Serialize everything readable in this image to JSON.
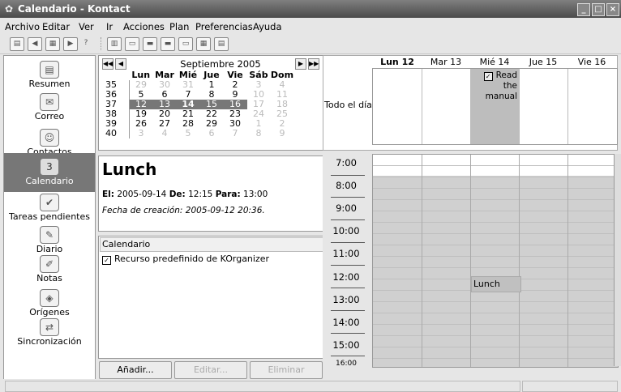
{
  "window": {
    "title": "Calendario - Kontact"
  },
  "menu": [
    "Archivo",
    "Editar",
    "Ver",
    "Ir",
    "Acciones",
    "Plan",
    "Preferencias",
    "Ayuda"
  ],
  "sidebar": {
    "items": [
      {
        "label": "Resumen",
        "icon": "summary-icon"
      },
      {
        "label": "Correo",
        "icon": "mail-icon"
      },
      {
        "label": "Contactos",
        "icon": "contacts-icon"
      },
      {
        "label": "Calendario",
        "icon": "calendar-icon",
        "active": true
      },
      {
        "label": "Tareas pendientes",
        "icon": "todo-icon"
      },
      {
        "label": "Diario",
        "icon": "journal-icon"
      },
      {
        "label": "Notas",
        "icon": "notes-icon"
      },
      {
        "label": "Orígenes",
        "icon": "feeds-icon"
      },
      {
        "label": "Sincronización",
        "icon": "sync-icon"
      }
    ]
  },
  "minical": {
    "month": "Septiembre 2005",
    "headers": [
      "Lun",
      "Mar",
      "Mié",
      "Jue",
      "Vie",
      "Sáb",
      "Dom"
    ],
    "weeks": [
      {
        "wk": "35",
        "days": [
          "29",
          "30",
          "31",
          "1",
          "2",
          "3",
          "4"
        ]
      },
      {
        "wk": "36",
        "days": [
          "5",
          "6",
          "7",
          "8",
          "9",
          "10",
          "11"
        ]
      },
      {
        "wk": "37",
        "days": [
          "12",
          "13",
          "14",
          "15",
          "16",
          "17",
          "18"
        ]
      },
      {
        "wk": "38",
        "days": [
          "19",
          "20",
          "21",
          "22",
          "23",
          "24",
          "25"
        ]
      },
      {
        "wk": "39",
        "days": [
          "26",
          "27",
          "28",
          "29",
          "30",
          "1",
          "2"
        ]
      },
      {
        "wk": "40",
        "days": [
          "3",
          "4",
          "5",
          "6",
          "7",
          "8",
          "9"
        ]
      }
    ]
  },
  "detail": {
    "title": "Lunch",
    "el_label": "El:",
    "date": "2005-09-14",
    "de_label": "De:",
    "from": "12:15",
    "para_label": "Para:",
    "to": "13:00",
    "created": "Fecha de creación: 2005-09-12 20:36."
  },
  "resources": {
    "header": "Calendario",
    "item": "Recurso predefinido de KOrganizer"
  },
  "buttons": {
    "add": "Añadir...",
    "edit": "Editar...",
    "delete": "Eliminar"
  },
  "agenda": {
    "days": [
      "Lun 12",
      "Mar 13",
      "Mié 14",
      "Jue 15",
      "Vie 16"
    ],
    "allday_label": "Todo el día",
    "allday_event": "Read the manual",
    "hours": [
      "7:00",
      "8:00",
      "9:00",
      "10:00",
      "11:00",
      "12:00",
      "13:00",
      "14:00",
      "15:00",
      "16:00"
    ],
    "event": "Lunch"
  }
}
